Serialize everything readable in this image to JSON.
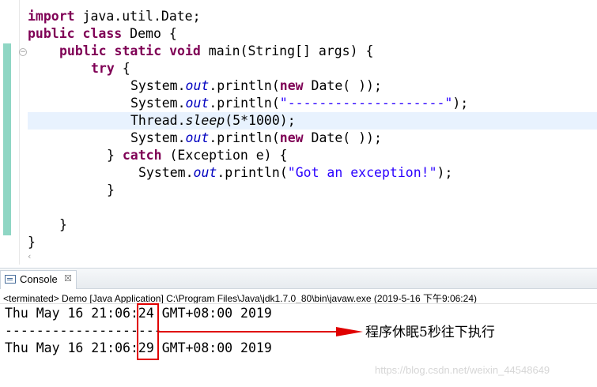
{
  "editor": {
    "lines": [
      {
        "kw": "import",
        "rest": " java.util.Date;"
      },
      {
        "kw1": "public",
        "kw2": "class",
        "rest": " Demo {"
      },
      {
        "kw1": "public",
        "kw2": "static",
        "kw3": "void",
        "rest": " main(String[] args) {"
      },
      {
        "kw": "try",
        "rest": " {"
      },
      {
        "a": "System.",
        "b": "out",
        "c": ".println(",
        "kw": "new",
        "d": " Date( ));"
      },
      {
        "a": "System.",
        "b": "out",
        "c": ".println(",
        "s": "\"--------------------\"",
        "d": ");"
      },
      {
        "a": "Thread.",
        "b": "sleep",
        "c": "(5*1000);"
      },
      {
        "a": "System.",
        "b": "out",
        "c": ".println(",
        "kw": "new",
        "d": " Date( ));"
      },
      {
        "a": "} ",
        "kw": "catch",
        "c": " (Exception e) {"
      },
      {
        "a": "System.",
        "b": "out",
        "c": ".println(",
        "s": "\"Got an exception!\"",
        "d": ");"
      },
      {
        "a": "}"
      },
      {
        "a": "}"
      },
      {
        "a": "}"
      }
    ]
  },
  "console": {
    "tab_label": "Console",
    "close_symbol": "☒",
    "terminated": "<terminated> Demo [Java Application] C:\\Program Files\\Java\\jdk1.7.0_80\\bin\\javaw.exe (2019-5-16 下午9:06:24)",
    "out1_pre": "Thu May 16 21:06:",
    "out1_sec": "24",
    "out1_post": " GMT+08:00 2019",
    "out2": "--------------------",
    "out3_pre": "Thu May 16 21:06:",
    "out3_sec": "29",
    "out3_post": " GMT+08:00 2019"
  },
  "annotation": "程序休眠5秒往下执行",
  "watermark": "https://blog.csdn.net/weixin_44548649",
  "colors": {
    "keyword": "#7f0055",
    "string": "#2a00ff",
    "field": "#0000c0",
    "accent": "#e00000"
  }
}
